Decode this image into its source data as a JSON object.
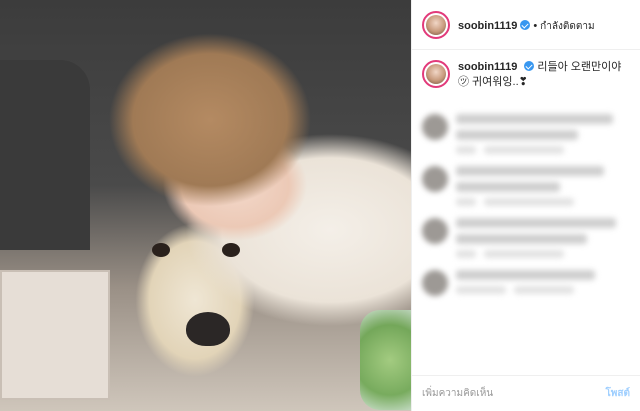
{
  "post": {
    "username": "soobin1119",
    "follow_label": "กำลังติดตาม",
    "caption": "리들아 오랜만이야㋡ 귀여워잉..❣",
    "add_comment_placeholder": "เพิ่มความคิดเห็น",
    "post_button": "โพสต์"
  },
  "colors": {
    "accent": "#3897f0",
    "story_ring": "#e23a7a"
  },
  "icons": {
    "verified": "verified-badge-icon"
  }
}
